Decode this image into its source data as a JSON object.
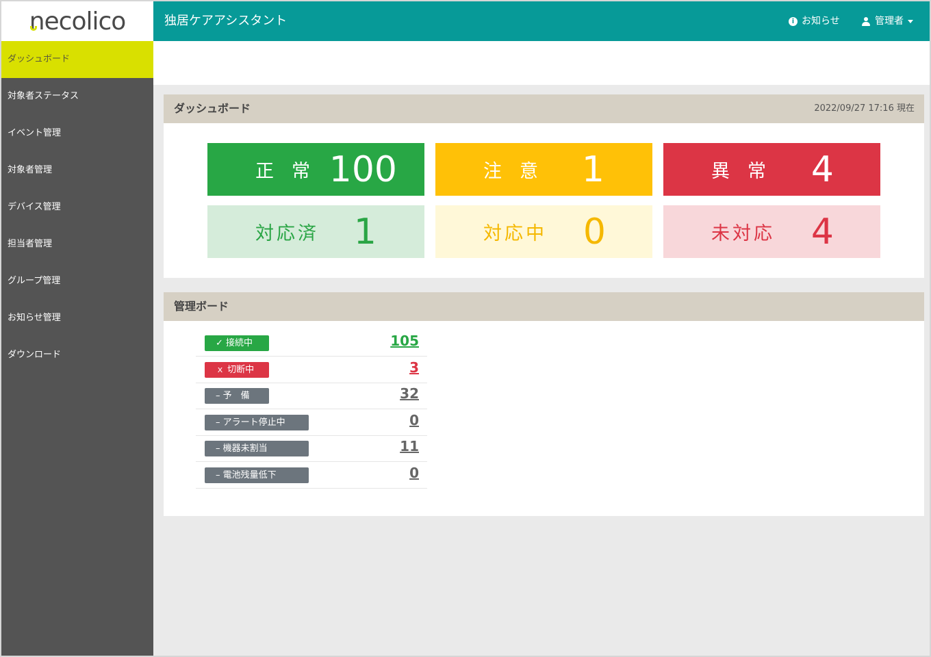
{
  "brand": {
    "logo_text": "necolico"
  },
  "sidebar": {
    "items": [
      {
        "label": "ダッシュボード",
        "active": true
      },
      {
        "label": "対象者ステータス"
      },
      {
        "label": "イベント管理"
      },
      {
        "label": "対象者管理"
      },
      {
        "label": "デバイス管理"
      },
      {
        "label": "担当者管理"
      },
      {
        "label": "グループ管理"
      },
      {
        "label": "お知らせ管理"
      },
      {
        "label": "ダウンロード"
      }
    ]
  },
  "header": {
    "title": "独居ケアアシスタント",
    "notice_label": "お知らせ",
    "user_label": "管理者"
  },
  "dashboard": {
    "title": "ダッシュボード",
    "updated": "2022/09/27 17:16 現在",
    "cards": [
      {
        "label": "正常",
        "value": "100"
      },
      {
        "label": "注意",
        "value": "1"
      },
      {
        "label": "異常",
        "value": "4"
      },
      {
        "label": "対応済",
        "value": "1"
      },
      {
        "label": "対応中",
        "value": "0"
      },
      {
        "label": "未対応",
        "value": "4"
      }
    ]
  },
  "management": {
    "title": "管理ボード",
    "rows": [
      {
        "badge": "✓ 接続中",
        "count": "105"
      },
      {
        "badge": "ｘ 切断中",
        "count": "3"
      },
      {
        "badge": "– 予　備",
        "count": "32"
      },
      {
        "badge": "– アラート停止中",
        "count": "0"
      },
      {
        "badge": "– 機器未割当",
        "count": "11"
      },
      {
        "badge": "– 電池残量低下",
        "count": "0"
      }
    ]
  },
  "colors": {
    "header": "#079a98",
    "sidebar": "#545454",
    "active_nav": "#d9e000",
    "normal": "#28a745",
    "caution": "#ffc107",
    "abnormal": "#dc3545"
  }
}
